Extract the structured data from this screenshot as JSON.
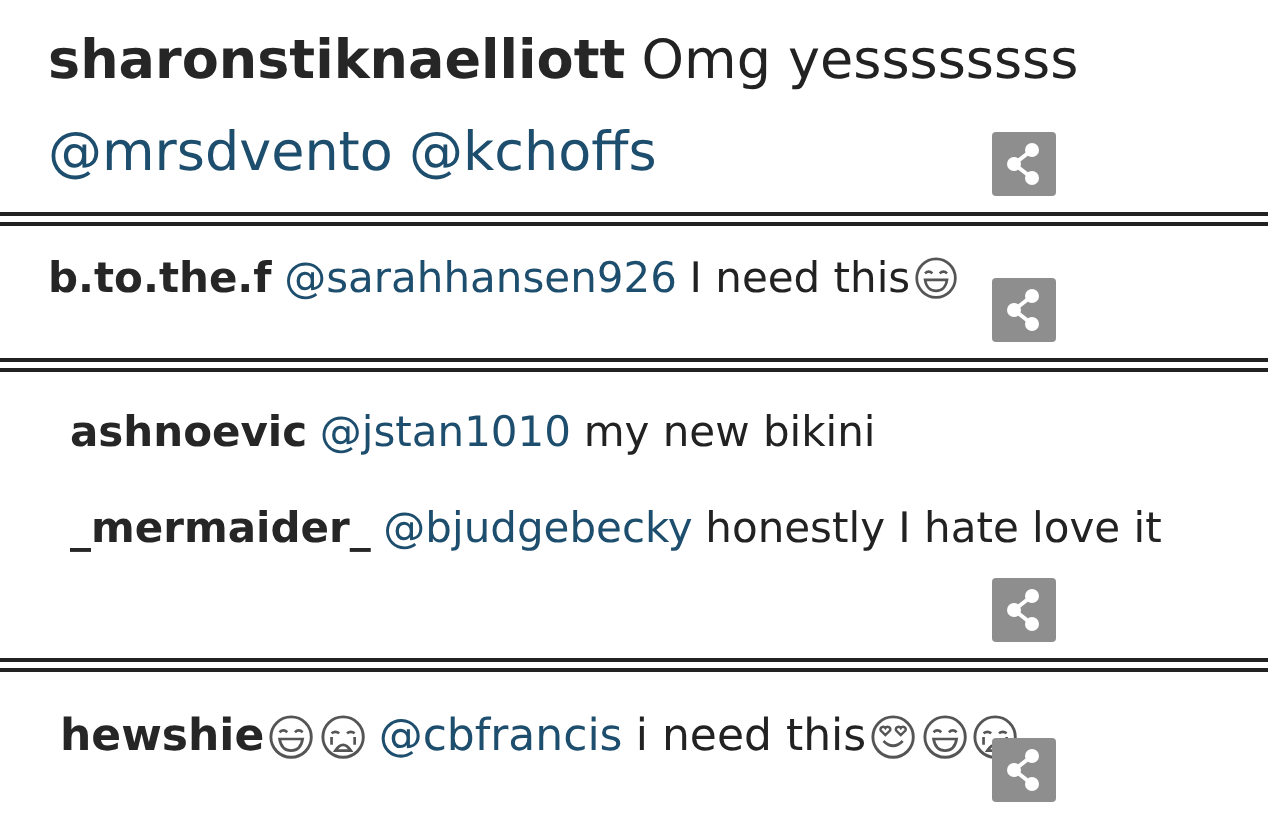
{
  "panels": [
    {
      "comments": [
        {
          "user": "sharonstiknaelliott",
          "parts": [
            {
              "kind": "text",
              "text": "Omg yessssssss"
            },
            {
              "kind": "break"
            },
            {
              "kind": "mention",
              "text": "@mrsdvento"
            },
            {
              "kind": "mention",
              "text": "@kchoffs"
            }
          ]
        }
      ]
    },
    {
      "comments": [
        {
          "user": "b.to.the.f",
          "parts": [
            {
              "kind": "mention",
              "text": "@sarahhansen926"
            },
            {
              "kind": "text",
              "text": "I need this"
            },
            {
              "kind": "laughing"
            }
          ]
        }
      ]
    },
    {
      "comments": [
        {
          "user": "ashnoevic",
          "parts": [
            {
              "kind": "mention",
              "text": "@jstan1010"
            },
            {
              "kind": "text",
              "text": "my new bikini"
            }
          ]
        },
        {
          "user": "_mermaider_",
          "parts": [
            {
              "kind": "mention",
              "text": "@bjudgebecky"
            },
            {
              "kind": "text",
              "text": "honestly I hate love it"
            }
          ]
        }
      ]
    },
    {
      "comments": [
        {
          "user": "hewshie",
          "parts": [
            {
              "kind": "laughing"
            },
            {
              "kind": "crying"
            },
            {
              "kind": "mention",
              "text": "@cbfrancis"
            },
            {
              "kind": "text",
              "text": "i need this"
            },
            {
              "kind": "hearteyes"
            },
            {
              "kind": "laughing"
            },
            {
              "kind": "crying"
            }
          ]
        }
      ]
    }
  ]
}
